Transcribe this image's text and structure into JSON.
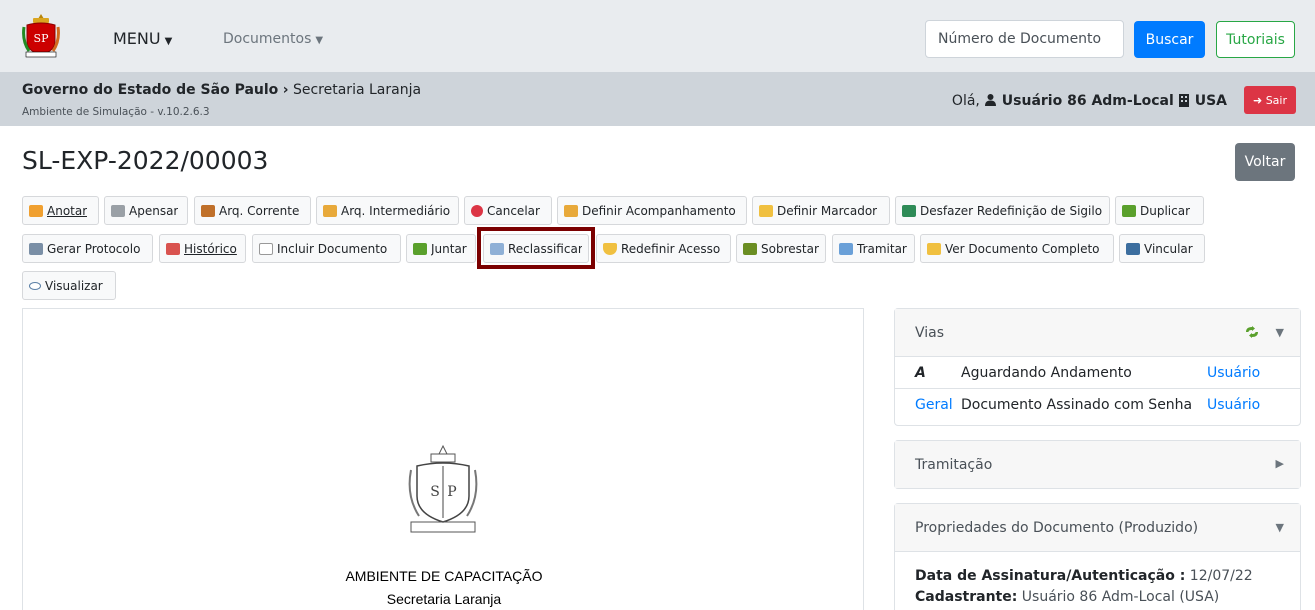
{
  "navbar": {
    "menu_label": "MENU",
    "docs_label": "Documentos",
    "search_placeholder": "Número de Documento",
    "buscar_label": "Buscar",
    "tutoriais_label": "Tutoriais"
  },
  "subbar": {
    "breadcrumb_root": "Governo do Estado de São Paulo",
    "breadcrumb_sep": "›",
    "breadcrumb_leaf": "Secretaria Laranja",
    "environment": "Ambiente de Simulação - v.10.2.6.3",
    "greeting": "Olá,",
    "user": "Usuário 86 Adm-Local",
    "unit": "USA",
    "sair_label": "Sair"
  },
  "page": {
    "title": "SL-EXP-2022/00003",
    "voltar_label": "Voltar"
  },
  "toolbar": {
    "row1": [
      "Anotar",
      "Apensar",
      "Arq. Corrente",
      "Arq. Intermediário",
      "Cancelar",
      "Definir Acompanhamento",
      "Definir Marcador",
      "Desfazer Redefinição de Sigilo",
      "Duplicar"
    ],
    "row2": [
      "Gerar Protocolo",
      "Histórico",
      "Incluir Documento",
      "Juntar",
      "Reclassificar",
      "Redefinir Acesso",
      "Sobrestar",
      "Tramitar",
      "Ver Documento Completo",
      "Vincular"
    ],
    "row3": [
      "Visualizar"
    ]
  },
  "document": {
    "heading": "AMBIENTE DE CAPACITAÇÃO",
    "subheading": "Secretaria Laranja"
  },
  "vias": {
    "title": "Vias",
    "rows": [
      {
        "via": "A",
        "status": "Aguardando Andamento",
        "link": "Usuário"
      },
      {
        "via": "Geral",
        "status": "Documento Assinado com Senha",
        "link": "Usuário"
      }
    ]
  },
  "tramitacao": {
    "title": "Tramitação"
  },
  "propriedades": {
    "title": "Propriedades do Documento (Produzido)",
    "assinatura_label": "Data de Assinatura/Autenticação :",
    "assinatura_value": "12/07/22",
    "cadastrante_label": "Cadastrante:",
    "cadastrante_value": "Usuário 86 Adm-Local (USA)"
  },
  "colors": {
    "primary": "#007bff",
    "success": "#28a745",
    "danger": "#dc3545",
    "secondary": "#6c757d",
    "highlight": "#7b0000"
  }
}
